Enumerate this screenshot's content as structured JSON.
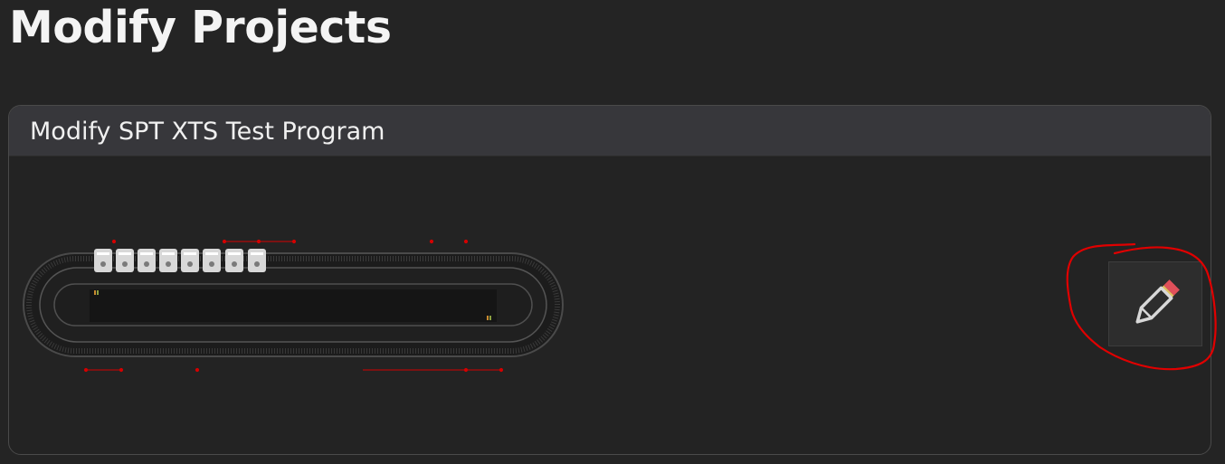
{
  "page": {
    "title": "Modify Projects"
  },
  "project_card": {
    "title": "Modify SPT XTS Test Program",
    "edit_button": {
      "icon": "pencil-icon"
    }
  },
  "colors": {
    "background": "#242424",
    "card_header": "#37373b",
    "annotation": "#e00000",
    "track_marker": "#d40000"
  }
}
